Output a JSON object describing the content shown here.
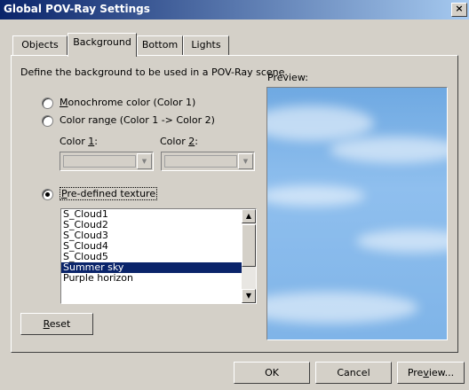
{
  "window": {
    "title": "Global POV-Ray Settings",
    "close_glyph": "×"
  },
  "tabs": [
    {
      "label": "Objects",
      "active": false
    },
    {
      "label": "Background",
      "active": true
    },
    {
      "label": "Bottom",
      "active": false
    },
    {
      "label": "Lights",
      "active": false
    }
  ],
  "panel": {
    "description": "Define the background to be used in a POV-Ray scene.",
    "options": {
      "monochrome": {
        "prefix": "",
        "hotkey": "M",
        "suffix": "onochrome color (Color 1)",
        "selected": false
      },
      "range": {
        "prefix": "Color ran",
        "hotkey": "g",
        "suffix": "e (Color 1 -> Color 2)",
        "selected": false
      },
      "predefined": {
        "prefix": "",
        "hotkey": "P",
        "suffix": "re-defined texture",
        "selected": true
      }
    },
    "color1": {
      "prefix": "Color ",
      "hotkey": "1",
      "suffix": ":"
    },
    "color2": {
      "prefix": "Color ",
      "hotkey": "2",
      "suffix": ":"
    },
    "textures": [
      "S_Cloud1",
      "S_Cloud2",
      "S_Cloud3",
      "S_Cloud4",
      "S_Cloud5",
      "Summer sky",
      "Purple horizon"
    ],
    "selected_texture": "Summer sky",
    "reset": {
      "prefix": "",
      "hotkey": "R",
      "suffix": "eset"
    },
    "preview_label": "Preview:"
  },
  "buttons": {
    "ok": "OK",
    "cancel": "Cancel",
    "preview": {
      "prefix": "Pre",
      "hotkey": "v",
      "suffix": "iew..."
    }
  },
  "icons": [
    "close-icon",
    "chevron-down-icon",
    "scroll-up-icon",
    "scroll-down-icon"
  ]
}
